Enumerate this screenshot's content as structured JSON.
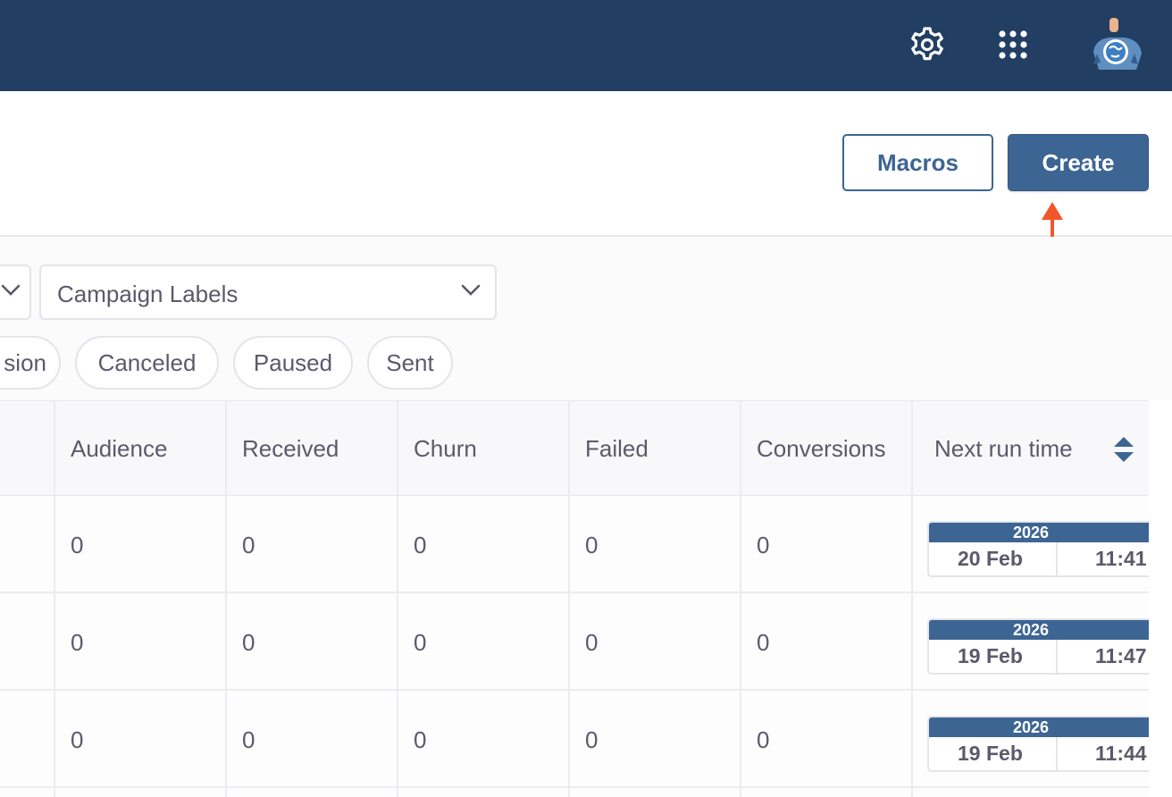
{
  "topbar": {
    "icons": [
      "gear-icon",
      "apps-grid-icon",
      "avatar"
    ],
    "colors": {
      "background": "#223e62"
    }
  },
  "header": {
    "macros_label": "Macros",
    "create_label": "Create",
    "colors": {
      "primary": "#3d6594",
      "annotation_arrow": "#f2562b"
    }
  },
  "filters": {
    "labels_dropdown": "Campaign Labels",
    "chips": [
      "sion",
      "Canceled",
      "Paused",
      "Sent"
    ]
  },
  "table": {
    "columns": [
      "Audience",
      "Received",
      "Churn",
      "Failed",
      "Conversions",
      "Next run time"
    ],
    "rows": [
      {
        "audience": "0",
        "received": "0",
        "churn": "0",
        "failed": "0",
        "conversions": "0",
        "next_run": {
          "year": "2026",
          "date": "20 Feb",
          "time": "11:41"
        }
      },
      {
        "audience": "0",
        "received": "0",
        "churn": "0",
        "failed": "0",
        "conversions": "0",
        "next_run": {
          "year": "2026",
          "date": "19 Feb",
          "time": "11:47"
        }
      },
      {
        "audience": "0",
        "received": "0",
        "churn": "0",
        "failed": "0",
        "conversions": "0",
        "next_run": {
          "year": "2026",
          "date": "19 Feb",
          "time": "11:44"
        }
      }
    ]
  }
}
